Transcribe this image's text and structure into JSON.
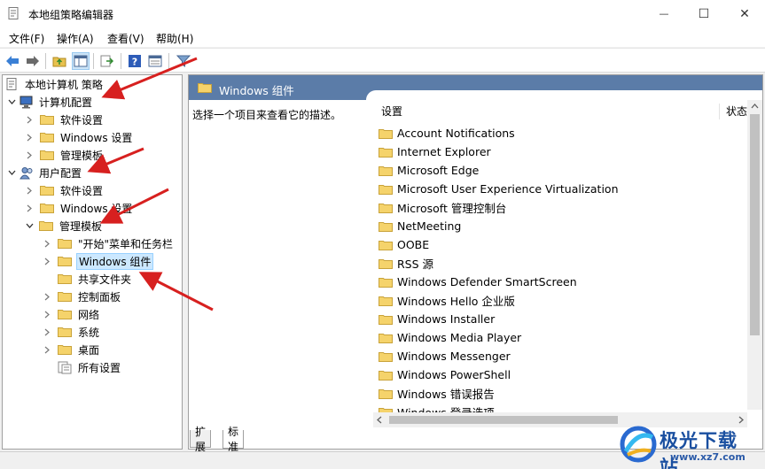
{
  "window": {
    "title": "本地组策略编辑器",
    "controls": {
      "minimize": "—",
      "maximize": "☐",
      "close": "✕"
    }
  },
  "menu": [
    "文件(F)",
    "操作(A)",
    "查看(V)",
    "帮助(H)"
  ],
  "toolbar": {
    "buttons": [
      "back-icon",
      "forward-icon",
      "up-folder-icon",
      "show-hide-tree-icon",
      "export-list-icon",
      "help-icon",
      "properties-icon",
      "filter-icon"
    ]
  },
  "tree": {
    "root": "本地计算机 策略",
    "computer_config": "计算机配置",
    "computer_children": [
      "软件设置",
      "Windows 设置",
      "管理模板"
    ],
    "user_config": "用户配置",
    "user_children": [
      "软件设置",
      "Windows 设置",
      "管理模板"
    ],
    "admin_templates_children": [
      "\"开始\"菜单和任务栏",
      "Windows 组件",
      "共享文件夹",
      "控制面板",
      "网络",
      "系统",
      "桌面",
      "所有设置"
    ],
    "selected": "Windows 组件"
  },
  "right_pane": {
    "header_title": "Windows 组件",
    "description": "选择一个项目来查看它的描述。",
    "columns": {
      "setting": "设置",
      "state": "状态"
    },
    "items": [
      "Account Notifications",
      "Internet Explorer",
      "Microsoft Edge",
      "Microsoft User Experience Virtualization",
      "Microsoft 管理控制台",
      "NetMeeting",
      "OOBE",
      "RSS 源",
      "Windows Defender SmartScreen",
      "Windows Hello 企业版",
      "Windows Installer",
      "Windows Media Player",
      "Windows Messenger",
      "Windows PowerShell",
      "Windows 错误报告",
      "Windows 登录选项"
    ]
  },
  "tabs": [
    "扩展",
    "标准"
  ],
  "watermark": {
    "name": "极光下载站",
    "url": "www.xz7.com"
  },
  "colors": {
    "header_bg": "#5b7ca8",
    "selection": "#cce8ff",
    "arrow": "#d7201f",
    "folder": "#f5d36b"
  }
}
